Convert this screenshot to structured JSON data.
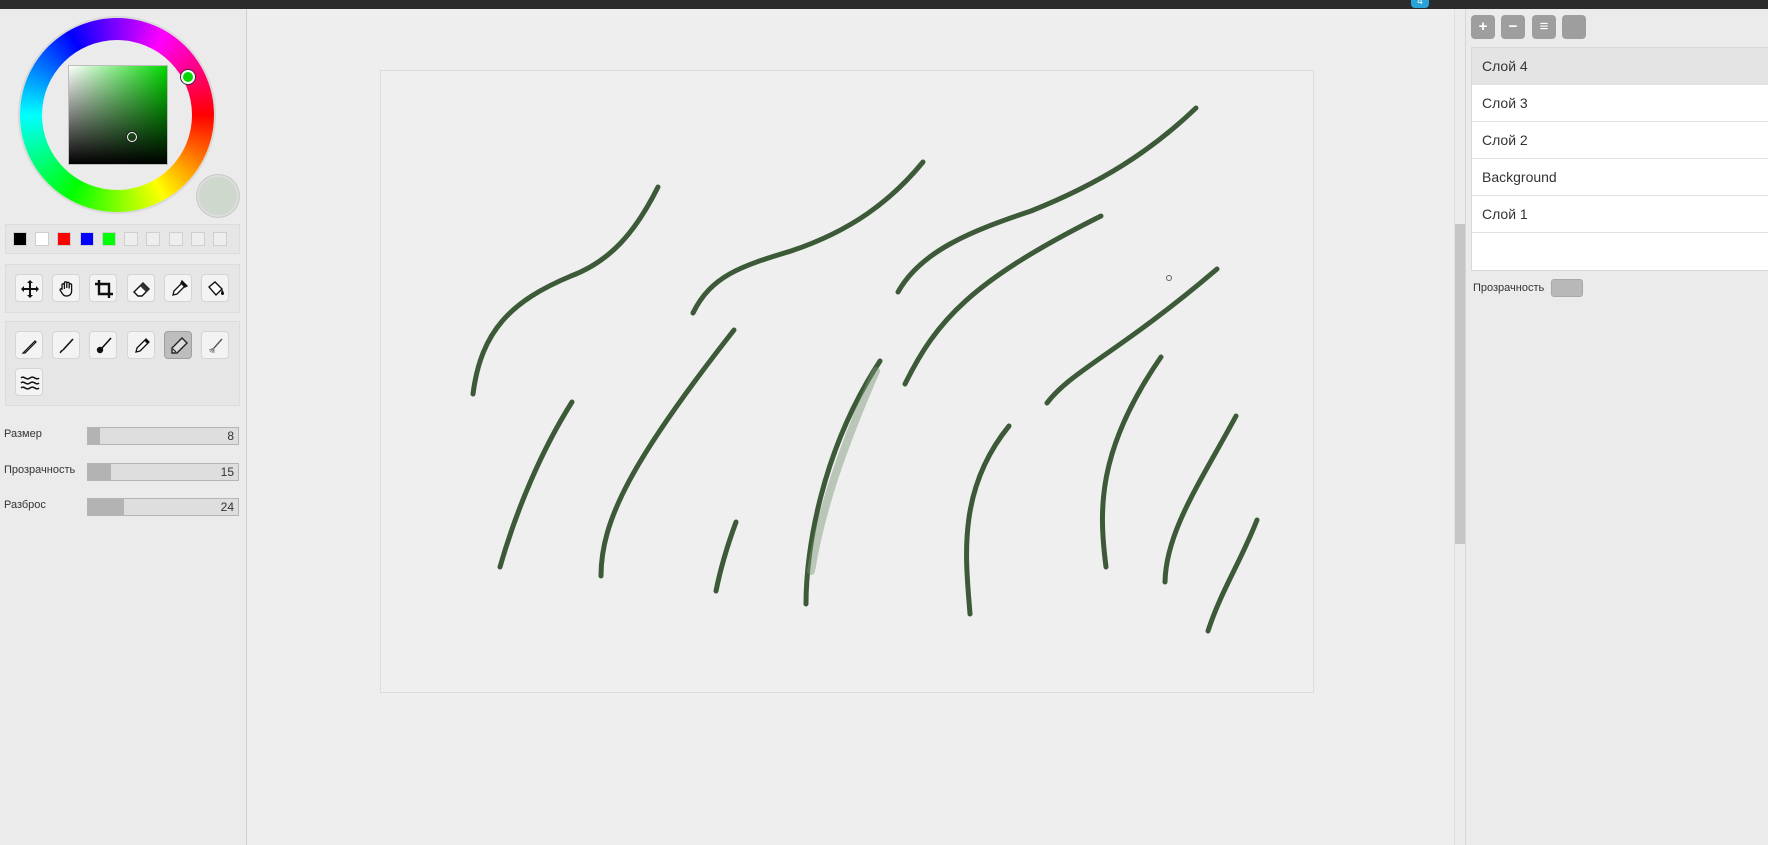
{
  "colors": {
    "accent": "#00d800",
    "current_color": "#ced8cc",
    "stroke_color": "#3c5a37"
  },
  "palette": [
    "#000000",
    "#ffffff",
    "#ff0000",
    "#0000ff",
    "#00ff00",
    "#eeeeee",
    "#eeeeee",
    "#eeeeee",
    "#eeeeee",
    "#eeeeee"
  ],
  "tools": {
    "row1": [
      "move-icon",
      "hand-icon",
      "crop-icon",
      "eraser-icon",
      "eyedropper-icon",
      "bucket-icon"
    ],
    "brushes": [
      "pencil-icon",
      "thin-brush-icon",
      "round-brush-icon",
      "pen-icon",
      "marker-icon",
      "fan-brush-icon",
      "wave-icon"
    ],
    "active_brush": "marker-icon"
  },
  "sliders": {
    "size": {
      "label": "Размер",
      "value": "8",
      "fraction": 0.08
    },
    "opacity": {
      "label": "Прозрачность",
      "value": "15",
      "fraction": 0.15
    },
    "scatter": {
      "label": "Разброс",
      "value": "24",
      "fraction": 0.24
    }
  },
  "layers": {
    "buttons": [
      "+",
      "−",
      "≡"
    ],
    "items": [
      "Слой 4",
      "Слой 3",
      "Слой 2",
      "Background",
      "Слой 1"
    ],
    "selected_index": 0,
    "opacity_label": "Прозрачность"
  },
  "topbar": {
    "badge": "4"
  }
}
